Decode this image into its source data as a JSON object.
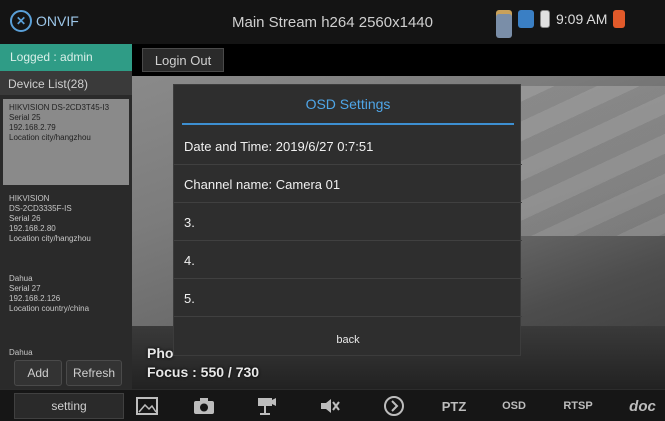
{
  "statusbar": {
    "app_name": "ONVIF",
    "stream_title": "Main Stream h264 2560x1440",
    "clock": "9:09 AM",
    "icons": [
      "sd-card-icon",
      "app-icon",
      "tool-icon",
      "battery-icon",
      "warning-icon"
    ]
  },
  "sidebar": {
    "logged": "Logged : admin",
    "device_list_title": "Device List(28)",
    "devices": [
      {
        "lines": "HIKVISION DS-2CD3T45-I3\nSerial 25\n192.168.2.79\nLocation city/hangzhou"
      },
      {
        "lines": "HIKVISION\nDS-2CD3335F-IS\nSerial 26\n192.168.2.80\nLocation city/hangzhou"
      },
      {
        "lines": "Dahua\nSerial 27\n192.168.2.126\nLocation country/china"
      },
      {
        "lines": "Dahua"
      }
    ],
    "add_label": "Add",
    "refresh_label": "Refresh"
  },
  "header": {
    "login_out_label": "Login Out"
  },
  "video": {
    "phone_label": "Pho",
    "focus_label": "Focus : 550 / 730"
  },
  "modal": {
    "title": "OSD Settings",
    "rows": [
      "Date and Time: 2019/6/27 0:7:51",
      "Channel name: Camera 01",
      "3.",
      "4.",
      "5."
    ],
    "back_label": "back"
  },
  "toolbar": {
    "setting_label": "setting",
    "ptz_label": "PTZ",
    "osd_label": "OSD",
    "rtsp_label": "RTSP",
    "doc_label": "doc"
  },
  "colors": {
    "accent": "#4fa6e8",
    "logged_bg": "#2f9c86",
    "modal_bg": "#2e2e2e"
  }
}
